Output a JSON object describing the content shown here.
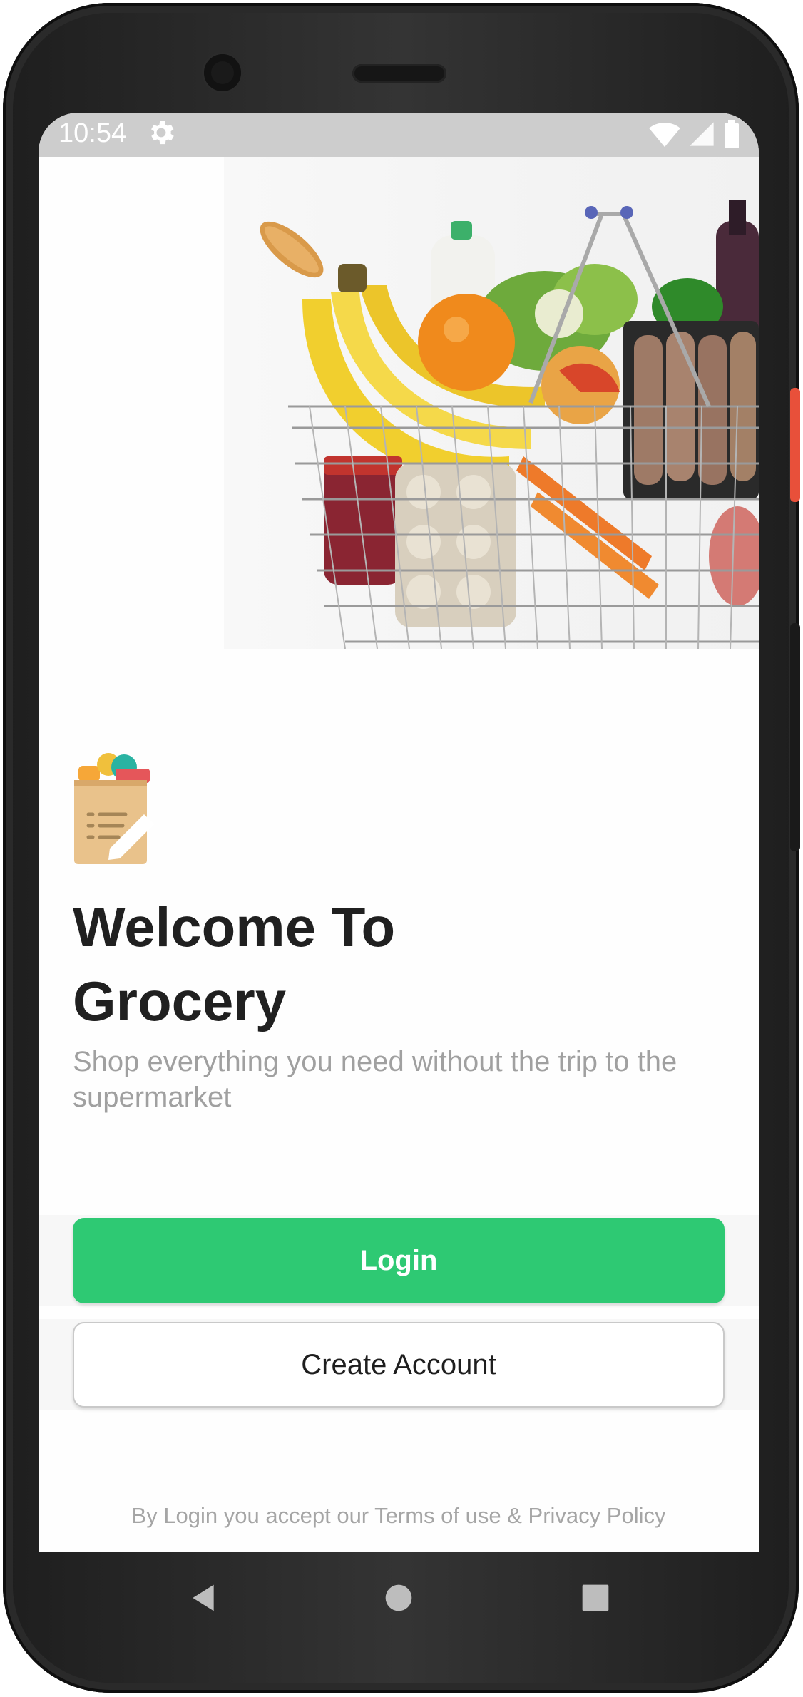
{
  "status_bar": {
    "time": "10:54",
    "settings_icon": "gear-icon",
    "wifi_icon": "wifi-icon",
    "signal_icon": "signal-icon",
    "battery_icon": "battery-icon"
  },
  "hero": {
    "image": "grocery-basket-image"
  },
  "logo": {
    "icon": "grocery-bag-notepad-icon"
  },
  "welcome": {
    "title_line1": "Welcome To",
    "title_line2": "Grocery",
    "subtitle": "Shop everything you need without the trip to the supermarket"
  },
  "actions": {
    "login_label": "Login",
    "create_account_label": "Create Account"
  },
  "footer": {
    "terms_text": "By Login you accept our Terms of use & Privacy Policy"
  },
  "navigation": {
    "back_icon": "back-triangle-icon",
    "home_icon": "home-circle-icon",
    "recents_icon": "recents-square-icon"
  },
  "colors": {
    "primary": "#2ec973",
    "title": "#202020",
    "subtitle": "#a0a0a0",
    "status_bar": "#cdcdcd"
  }
}
